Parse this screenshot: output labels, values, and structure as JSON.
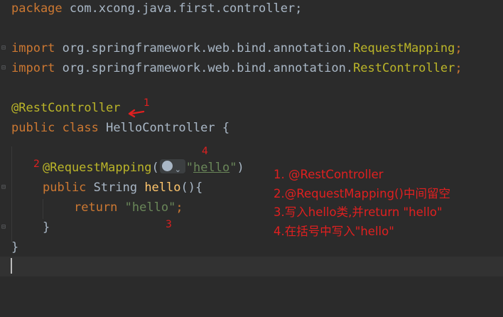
{
  "editor": {
    "lines": {
      "package_kw": "package",
      "package_name": " com.xcong.java.first.controller;",
      "import1_kw": "import",
      "import1_path": " org.springframework.web.bind.annotation.",
      "import1_class": "RequestMapping",
      "import1_semi": ";",
      "import2_kw": "import",
      "import2_path": " org.springframework.web.bind.annotation.",
      "import2_class": "RestController",
      "import2_semi": ";",
      "class_annotation": "@RestController",
      "class_public": "public",
      "class_class": " class",
      "class_name": " HelloController {",
      "method_annotation": "@RequestMapping",
      "method_paren_open": "(",
      "method_quote_open": "\"",
      "method_string": "hello",
      "method_quote_close": "\"",
      "method_paren_close": ")",
      "method_public": "public",
      "method_type": " String ",
      "method_name": "hello",
      "method_sig_tail": "(){",
      "return_kw": "return",
      "return_value": " \"hello\"",
      "return_semi": ";",
      "method_close": "}",
      "class_close": "}"
    },
    "icons": {
      "fold_marker": "fold-icon",
      "globe": "globe-icon",
      "chevron": "chevron-down-icon"
    },
    "colors": {
      "background": "#2b2b2b",
      "keyword": "#cc7832",
      "annotation": "#bbb529",
      "string": "#6a8759",
      "method": "#ffc66d",
      "text": "#a9b7c6",
      "markup_red": "#e02020"
    }
  },
  "annotations": {
    "markers": [
      "1",
      "2",
      "3",
      "4"
    ],
    "notes": [
      "1. @RestController",
      "2.@RequestMapping()中间留空",
      "3.写入hello类,并return \"hello\"",
      "4.在括号中写入\"hello\""
    ]
  }
}
